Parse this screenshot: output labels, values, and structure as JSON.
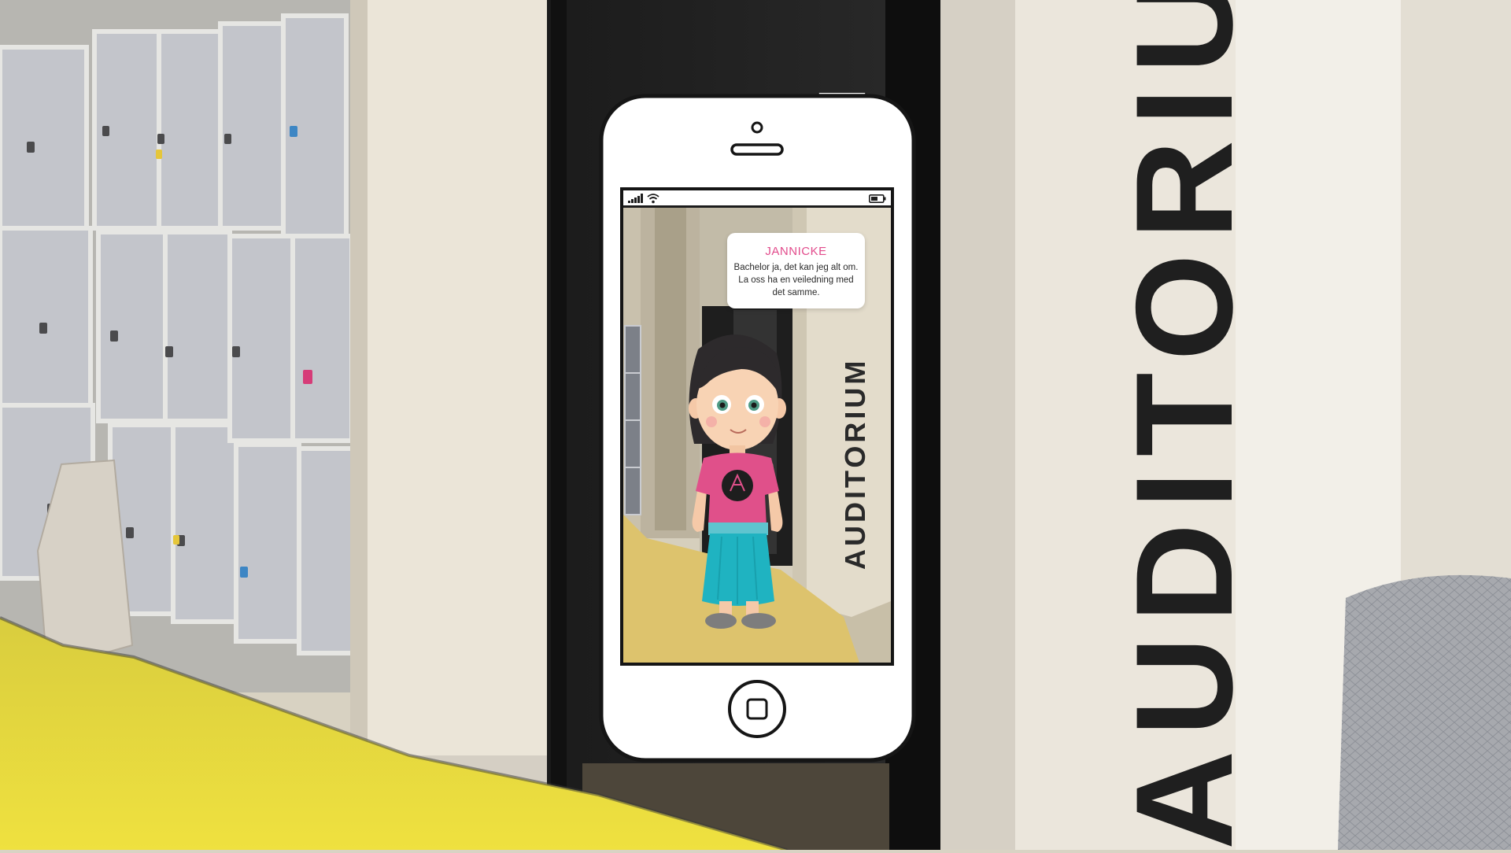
{
  "background": {
    "wall_sign": "AUDITORIU"
  },
  "phone": {
    "status_bar": {
      "signal_icon": "signal-bars-icon",
      "wifi_icon": "wifi-icon",
      "battery_icon": "battery-icon"
    },
    "home_button_icon": "home-square-icon",
    "screen": {
      "scene_sign": "AUDITORIUM",
      "dialog": {
        "speaker": "JANNICKE",
        "text": "Bachelor ja, det kan jeg alt om. La oss ha en veiledning med det samme."
      }
    }
  },
  "colors": {
    "floor_yellow": "#e7d93a",
    "speaker_pink": "#e24c8c",
    "shirt_pink": "#e0508a",
    "skirt_teal": "#1fb3c1",
    "scene_floor": "#ddc36d"
  }
}
